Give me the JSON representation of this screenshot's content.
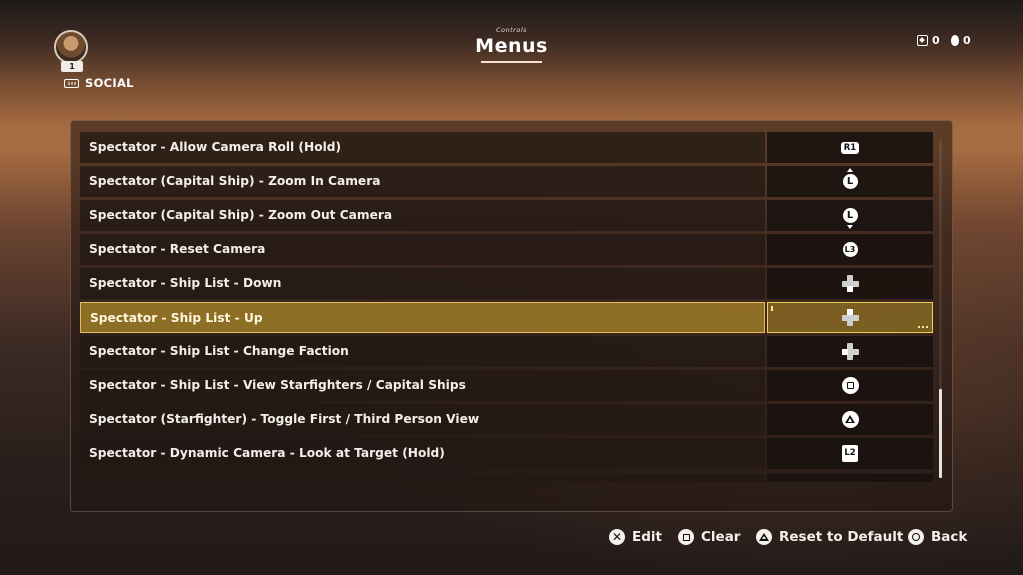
{
  "header": {
    "subtitle": "Controls",
    "title": "Menus",
    "player": {
      "level": "1",
      "social_label": "SOCIAL"
    },
    "currency": [
      {
        "icon": "credits-icon",
        "value": "0"
      },
      {
        "icon": "crystals-icon",
        "value": "0"
      }
    ]
  },
  "bindings": [
    {
      "action": "Spectator - Allow Camera Roll (Hold)",
      "button": "R1",
      "icon": "r1-button-icon"
    },
    {
      "action": "Spectator (Capital Ship) - Zoom In Camera",
      "button": "L",
      "icon": "left-stick-up-icon"
    },
    {
      "action": "Spectator (Capital Ship) - Zoom Out Camera",
      "button": "L",
      "icon": "left-stick-down-icon"
    },
    {
      "action": "Spectator - Reset Camera",
      "button": "L3",
      "icon": "l3-button-icon"
    },
    {
      "action": "Spectator - Ship List - Down",
      "button": "",
      "icon": "dpad-down-icon"
    },
    {
      "action": "Spectator - Ship List - Up",
      "button": "",
      "icon": "dpad-up-icon",
      "selected": true
    },
    {
      "action": "Spectator - Ship List - Change Faction",
      "button": "",
      "icon": "dpad-left-icon"
    },
    {
      "action": "Spectator - Ship List - View Starfighters / Capital Ships",
      "button": "",
      "icon": "square-button-icon"
    },
    {
      "action": "Spectator (Starfighter) - Toggle First / Third Person View",
      "button": "",
      "icon": "triangle-button-icon"
    },
    {
      "action": "Spectator - Dynamic Camera - Look at Target (Hold)",
      "button": "L2",
      "icon": "l2-button-icon"
    }
  ],
  "footer": {
    "hints": [
      {
        "label": "Edit",
        "icon": "cross-button-icon"
      },
      {
        "label": "Clear",
        "icon": "square-button-icon"
      },
      {
        "label": "Reset to Default",
        "icon": "triangle-button-icon"
      },
      {
        "label": "Back",
        "icon": "circle-button-icon"
      }
    ]
  },
  "colors": {
    "selection": "#efd05a",
    "row_bg": "#221814",
    "text": "#f4efe9"
  }
}
